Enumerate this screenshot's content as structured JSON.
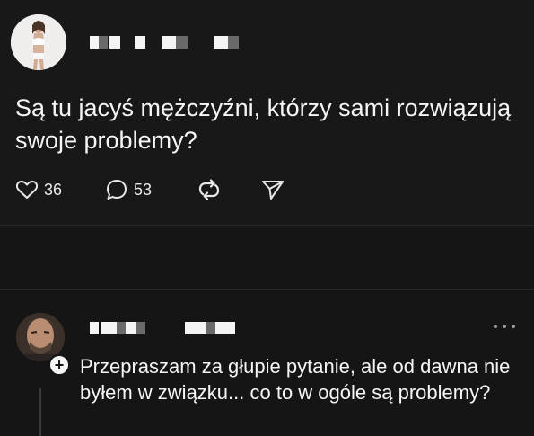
{
  "post": {
    "text": "Są tu jacyś mężczyźni, którzy sami rozwiązują swoje problemy?",
    "actions": {
      "likes": "36",
      "comments": "53"
    }
  },
  "reply": {
    "text": "Przepraszam za głupie pytanie, ale od dawna nie byłem w związku... co to w ogóle są problemy?"
  },
  "icons": {
    "like": "heart-icon",
    "comment": "comment-bubble-icon",
    "repost": "repost-icon",
    "share": "send-icon",
    "more": "more-dots-icon",
    "follow": "plus-icon"
  },
  "colors": {
    "background": "#151515",
    "text": "#f5f5f5"
  }
}
